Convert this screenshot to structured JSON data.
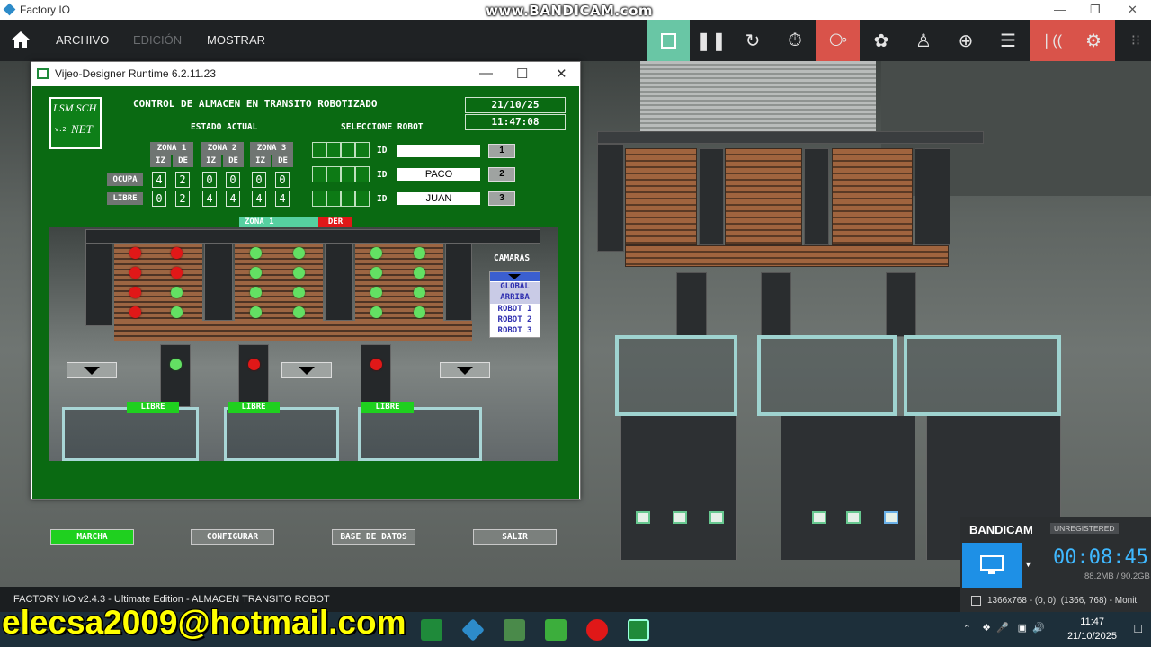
{
  "window_title": "Factory IO",
  "watermark_top": "www.BANDICAM.com",
  "menu": {
    "archivo": "ARCHIVO",
    "edicion": "EDICIÓN",
    "mostrar": "MOSTRAR"
  },
  "toolbar_icons": [
    "stop-icon",
    "pause-icon",
    "reset-icon",
    "timer-icon",
    "camera-fly-icon",
    "camera-orbit-icon",
    "first-person-icon",
    "target-icon",
    "list-icon",
    "sensor-icon",
    "drivers-icon",
    "apps-icon"
  ],
  "vijeo": {
    "title": "Vijeo-Designer Runtime 6.2.11.23",
    "logo_text": [
      "LSM SCH",
      "v.2",
      "NET"
    ],
    "heading": "CONTROL DE ALMACEN EN TRANSITO ROBOTIZADO",
    "date": "21/10/25",
    "time": "11:47:08",
    "estado_actual": "ESTADO ACTUAL",
    "seleccione_robot": "SELECCIONE ROBOT",
    "zones": [
      "ZONA 1",
      "ZONA 2",
      "ZONA 3"
    ],
    "sides": [
      "IZ",
      "DE"
    ],
    "row_labels": {
      "ocupa": "OCUPA",
      "libre": "LIBRE"
    },
    "ocupa": [
      4,
      2,
      0,
      0,
      0,
      0
    ],
    "libre": [
      0,
      2,
      4,
      4,
      4,
      4
    ],
    "id_label": "ID",
    "robots": [
      {
        "id": "",
        "button": "1"
      },
      {
        "id": "PACO",
        "button": "2"
      },
      {
        "id": "JUAN",
        "button": "3"
      }
    ],
    "zone_indicator": "ZONA 1",
    "side_indicator": "DER",
    "camaras_label": "CAMARAS",
    "camera_options": [
      "GLOBAL",
      "ARRIBA",
      "ROBOT 1",
      "ROBOT 2",
      "ROBOT 3"
    ],
    "libre_labels": [
      "LIBRE",
      "LIBRE",
      "LIBRE"
    ],
    "bottom_buttons": {
      "marcha": "MARCHA",
      "configurar": "CONFIGURAR",
      "base_datos": "BASE DE DATOS",
      "salir": "SALIR"
    },
    "colors": {
      "hmi_bg": "#0a6a12",
      "occupied": "#e01818",
      "free": "#63e063",
      "active": "#1fd01f"
    }
  },
  "status_bar": "FACTORY I/O v2.4.3 - Ultimate Edition - ALMACEN TRANSITO ROBOT",
  "email_watermark": "elecsa2009@hotmail.com",
  "bandicam": {
    "brand": "BANDICAM",
    "unregistered": "UNREGISTERED",
    "elapsed": "00:08:45",
    "size": "88.2MB / 90.2GB",
    "resolution": "1366x768 - (0, 0), (1366, 768) - Monit"
  },
  "clock": {
    "time": "11:47",
    "date": "21/10/2025"
  }
}
